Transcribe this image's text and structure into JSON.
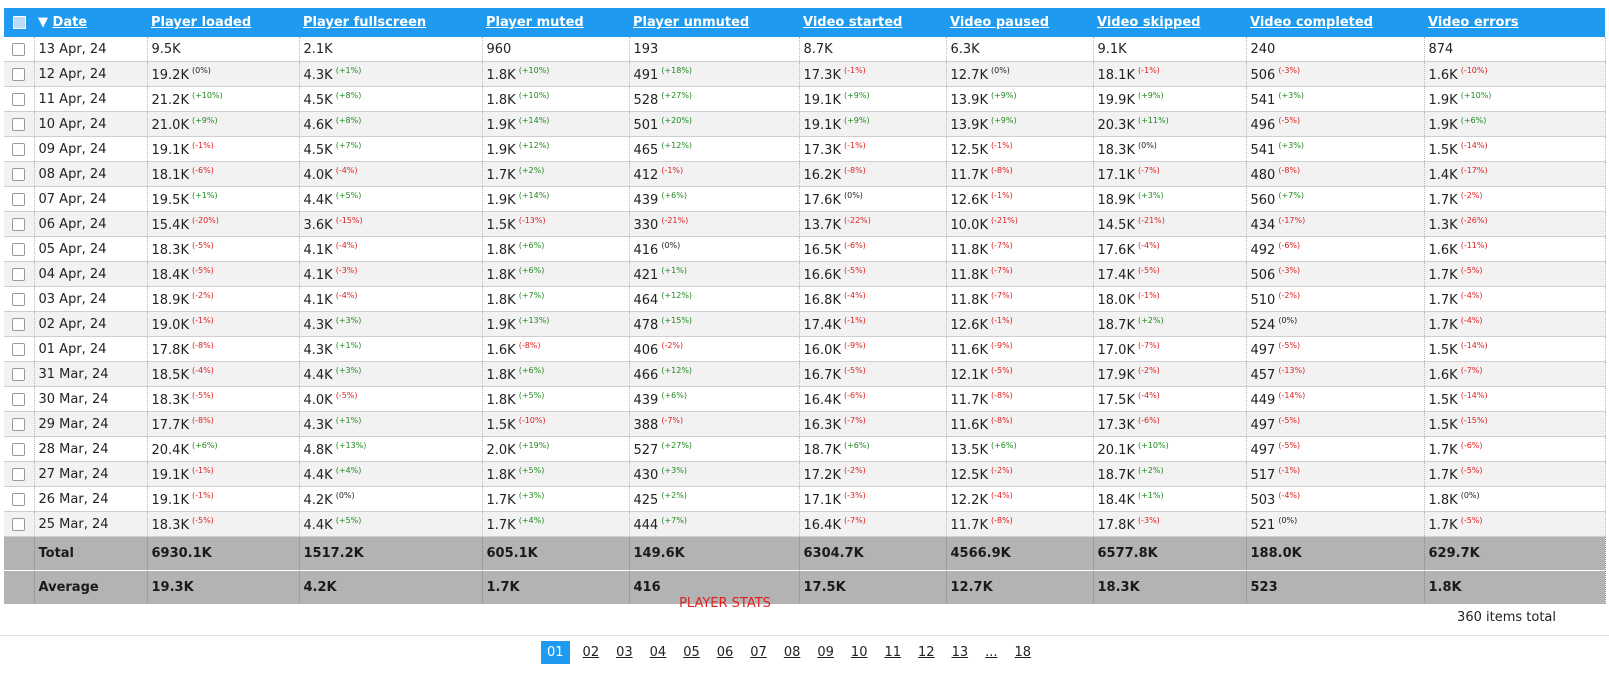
{
  "columns": {
    "date": "Date",
    "sort_glyph": "▼",
    "metrics": [
      "Player loaded",
      "Player fullscreen",
      "Player muted",
      "Player unmuted",
      "Video started",
      "Video paused",
      "Video skipped",
      "Video completed",
      "Video errors"
    ]
  },
  "rows": [
    {
      "date": "13 Apr, 24",
      "cells": [
        [
          "9.5K",
          ""
        ],
        [
          "2.1K",
          ""
        ],
        [
          "960",
          ""
        ],
        [
          "193",
          ""
        ],
        [
          "8.7K",
          ""
        ],
        [
          "6.3K",
          ""
        ],
        [
          "9.1K",
          ""
        ],
        [
          "240",
          ""
        ],
        [
          "874",
          ""
        ]
      ]
    },
    {
      "date": "12 Apr, 24",
      "cells": [
        [
          "19.2K",
          "(0%)"
        ],
        [
          "4.3K",
          "(+1%)"
        ],
        [
          "1.8K",
          "(+10%)"
        ],
        [
          "491",
          "(+18%)"
        ],
        [
          "17.3K",
          "(-1%)"
        ],
        [
          "12.7K",
          "(0%)"
        ],
        [
          "18.1K",
          "(-1%)"
        ],
        [
          "506",
          "(-3%)"
        ],
        [
          "1.6K",
          "(-10%)"
        ]
      ]
    },
    {
      "date": "11 Apr, 24",
      "cells": [
        [
          "21.2K",
          "(+10%)"
        ],
        [
          "4.5K",
          "(+8%)"
        ],
        [
          "1.8K",
          "(+10%)"
        ],
        [
          "528",
          "(+27%)"
        ],
        [
          "19.1K",
          "(+9%)"
        ],
        [
          "13.9K",
          "(+9%)"
        ],
        [
          "19.9K",
          "(+9%)"
        ],
        [
          "541",
          "(+3%)"
        ],
        [
          "1.9K",
          "(+10%)"
        ]
      ]
    },
    {
      "date": "10 Apr, 24",
      "cells": [
        [
          "21.0K",
          "(+9%)"
        ],
        [
          "4.6K",
          "(+8%)"
        ],
        [
          "1.9K",
          "(+14%)"
        ],
        [
          "501",
          "(+20%)"
        ],
        [
          "19.1K",
          "(+9%)"
        ],
        [
          "13.9K",
          "(+9%)"
        ],
        [
          "20.3K",
          "(+11%)"
        ],
        [
          "496",
          "(-5%)"
        ],
        [
          "1.9K",
          "(+6%)"
        ]
      ]
    },
    {
      "date": "09 Apr, 24",
      "cells": [
        [
          "19.1K",
          "(-1%)"
        ],
        [
          "4.5K",
          "(+7%)"
        ],
        [
          "1.9K",
          "(+12%)"
        ],
        [
          "465",
          "(+12%)"
        ],
        [
          "17.3K",
          "(-1%)"
        ],
        [
          "12.5K",
          "(-1%)"
        ],
        [
          "18.3K",
          "(0%)"
        ],
        [
          "541",
          "(+3%)"
        ],
        [
          "1.5K",
          "(-14%)"
        ]
      ]
    },
    {
      "date": "08 Apr, 24",
      "cells": [
        [
          "18.1K",
          "(-6%)"
        ],
        [
          "4.0K",
          "(-4%)"
        ],
        [
          "1.7K",
          "(+2%)"
        ],
        [
          "412",
          "(-1%)"
        ],
        [
          "16.2K",
          "(-8%)"
        ],
        [
          "11.7K",
          "(-8%)"
        ],
        [
          "17.1K",
          "(-7%)"
        ],
        [
          "480",
          "(-8%)"
        ],
        [
          "1.4K",
          "(-17%)"
        ]
      ]
    },
    {
      "date": "07 Apr, 24",
      "cells": [
        [
          "19.5K",
          "(+1%)"
        ],
        [
          "4.4K",
          "(+5%)"
        ],
        [
          "1.9K",
          "(+14%)"
        ],
        [
          "439",
          "(+6%)"
        ],
        [
          "17.6K",
          "(0%)"
        ],
        [
          "12.6K",
          "(-1%)"
        ],
        [
          "18.9K",
          "(+3%)"
        ],
        [
          "560",
          "(+7%)"
        ],
        [
          "1.7K",
          "(-2%)"
        ]
      ]
    },
    {
      "date": "06 Apr, 24",
      "cells": [
        [
          "15.4K",
          "(-20%)"
        ],
        [
          "3.6K",
          "(-15%)"
        ],
        [
          "1.5K",
          "(-13%)"
        ],
        [
          "330",
          "(-21%)"
        ],
        [
          "13.7K",
          "(-22%)"
        ],
        [
          "10.0K",
          "(-21%)"
        ],
        [
          "14.5K",
          "(-21%)"
        ],
        [
          "434",
          "(-17%)"
        ],
        [
          "1.3K",
          "(-26%)"
        ]
      ]
    },
    {
      "date": "05 Apr, 24",
      "cells": [
        [
          "18.3K",
          "(-5%)"
        ],
        [
          "4.1K",
          "(-4%)"
        ],
        [
          "1.8K",
          "(+6%)"
        ],
        [
          "416",
          "(0%)"
        ],
        [
          "16.5K",
          "(-6%)"
        ],
        [
          "11.8K",
          "(-7%)"
        ],
        [
          "17.6K",
          "(-4%)"
        ],
        [
          "492",
          "(-6%)"
        ],
        [
          "1.6K",
          "(-11%)"
        ]
      ]
    },
    {
      "date": "04 Apr, 24",
      "cells": [
        [
          "18.4K",
          "(-5%)"
        ],
        [
          "4.1K",
          "(-3%)"
        ],
        [
          "1.8K",
          "(+6%)"
        ],
        [
          "421",
          "(+1%)"
        ],
        [
          "16.6K",
          "(-5%)"
        ],
        [
          "11.8K",
          "(-7%)"
        ],
        [
          "17.4K",
          "(-5%)"
        ],
        [
          "506",
          "(-3%)"
        ],
        [
          "1.7K",
          "(-5%)"
        ]
      ]
    },
    {
      "date": "03 Apr, 24",
      "cells": [
        [
          "18.9K",
          "(-2%)"
        ],
        [
          "4.1K",
          "(-4%)"
        ],
        [
          "1.8K",
          "(+7%)"
        ],
        [
          "464",
          "(+12%)"
        ],
        [
          "16.8K",
          "(-4%)"
        ],
        [
          "11.8K",
          "(-7%)"
        ],
        [
          "18.0K",
          "(-1%)"
        ],
        [
          "510",
          "(-2%)"
        ],
        [
          "1.7K",
          "(-4%)"
        ]
      ]
    },
    {
      "date": "02 Apr, 24",
      "cells": [
        [
          "19.0K",
          "(-1%)"
        ],
        [
          "4.3K",
          "(+3%)"
        ],
        [
          "1.9K",
          "(+13%)"
        ],
        [
          "478",
          "(+15%)"
        ],
        [
          "17.4K",
          "(-1%)"
        ],
        [
          "12.6K",
          "(-1%)"
        ],
        [
          "18.7K",
          "(+2%)"
        ],
        [
          "524",
          "(0%)"
        ],
        [
          "1.7K",
          "(-4%)"
        ]
      ]
    },
    {
      "date": "01 Apr, 24",
      "cells": [
        [
          "17.8K",
          "(-8%)"
        ],
        [
          "4.3K",
          "(+1%)"
        ],
        [
          "1.6K",
          "(-8%)"
        ],
        [
          "406",
          "(-2%)"
        ],
        [
          "16.0K",
          "(-9%)"
        ],
        [
          "11.6K",
          "(-9%)"
        ],
        [
          "17.0K",
          "(-7%)"
        ],
        [
          "497",
          "(-5%)"
        ],
        [
          "1.5K",
          "(-14%)"
        ]
      ]
    },
    {
      "date": "31 Mar, 24",
      "cells": [
        [
          "18.5K",
          "(-4%)"
        ],
        [
          "4.4K",
          "(+3%)"
        ],
        [
          "1.8K",
          "(+6%)"
        ],
        [
          "466",
          "(+12%)"
        ],
        [
          "16.7K",
          "(-5%)"
        ],
        [
          "12.1K",
          "(-5%)"
        ],
        [
          "17.9K",
          "(-2%)"
        ],
        [
          "457",
          "(-13%)"
        ],
        [
          "1.6K",
          "(-7%)"
        ]
      ]
    },
    {
      "date": "30 Mar, 24",
      "cells": [
        [
          "18.3K",
          "(-5%)"
        ],
        [
          "4.0K",
          "(-5%)"
        ],
        [
          "1.8K",
          "(+5%)"
        ],
        [
          "439",
          "(+6%)"
        ],
        [
          "16.4K",
          "(-6%)"
        ],
        [
          "11.7K",
          "(-8%)"
        ],
        [
          "17.5K",
          "(-4%)"
        ],
        [
          "449",
          "(-14%)"
        ],
        [
          "1.5K",
          "(-14%)"
        ]
      ]
    },
    {
      "date": "29 Mar, 24",
      "cells": [
        [
          "17.7K",
          "(-8%)"
        ],
        [
          "4.3K",
          "(+1%)"
        ],
        [
          "1.5K",
          "(-10%)"
        ],
        [
          "388",
          "(-7%)"
        ],
        [
          "16.3K",
          "(-7%)"
        ],
        [
          "11.6K",
          "(-8%)"
        ],
        [
          "17.3K",
          "(-6%)"
        ],
        [
          "497",
          "(-5%)"
        ],
        [
          "1.5K",
          "(-15%)"
        ]
      ]
    },
    {
      "date": "28 Mar, 24",
      "cells": [
        [
          "20.4K",
          "(+6%)"
        ],
        [
          "4.8K",
          "(+13%)"
        ],
        [
          "2.0K",
          "(+19%)"
        ],
        [
          "527",
          "(+27%)"
        ],
        [
          "18.7K",
          "(+6%)"
        ],
        [
          "13.5K",
          "(+6%)"
        ],
        [
          "20.1K",
          "(+10%)"
        ],
        [
          "497",
          "(-5%)"
        ],
        [
          "1.7K",
          "(-6%)"
        ]
      ]
    },
    {
      "date": "27 Mar, 24",
      "cells": [
        [
          "19.1K",
          "(-1%)"
        ],
        [
          "4.4K",
          "(+4%)"
        ],
        [
          "1.8K",
          "(+5%)"
        ],
        [
          "430",
          "(+3%)"
        ],
        [
          "17.2K",
          "(-2%)"
        ],
        [
          "12.5K",
          "(-2%)"
        ],
        [
          "18.7K",
          "(+2%)"
        ],
        [
          "517",
          "(-1%)"
        ],
        [
          "1.7K",
          "(-5%)"
        ]
      ]
    },
    {
      "date": "26 Mar, 24",
      "cells": [
        [
          "19.1K",
          "(-1%)"
        ],
        [
          "4.2K",
          "(0%)"
        ],
        [
          "1.7K",
          "(+3%)"
        ],
        [
          "425",
          "(+2%)"
        ],
        [
          "17.1K",
          "(-3%)"
        ],
        [
          "12.2K",
          "(-4%)"
        ],
        [
          "18.4K",
          "(+1%)"
        ],
        [
          "503",
          "(-4%)"
        ],
        [
          "1.8K",
          "(0%)"
        ]
      ]
    },
    {
      "date": "25 Mar, 24",
      "cells": [
        [
          "18.3K",
          "(-5%)"
        ],
        [
          "4.4K",
          "(+5%)"
        ],
        [
          "1.7K",
          "(+4%)"
        ],
        [
          "444",
          "(+7%)"
        ],
        [
          "16.4K",
          "(-7%)"
        ],
        [
          "11.7K",
          "(-8%)"
        ],
        [
          "17.8K",
          "(-3%)"
        ],
        [
          "521",
          "(0%)"
        ],
        [
          "1.7K",
          "(-5%)"
        ]
      ]
    }
  ],
  "totals": {
    "label": "Total",
    "values": [
      "6930.1K",
      "1517.2K",
      "605.1K",
      "149.6K",
      "6304.7K",
      "4566.9K",
      "6577.8K",
      "188.0K",
      "629.7K"
    ]
  },
  "averages": {
    "label": "Average",
    "values": [
      "19.3K",
      "4.2K",
      "1.7K",
      "416",
      "17.5K",
      "12.7K",
      "18.3K",
      "523",
      "1.8K"
    ]
  },
  "caption": "PLAYER STATS",
  "items_total": "360 items total",
  "pagination": {
    "pages": [
      "01",
      "02",
      "03",
      "04",
      "05",
      "06",
      "07",
      "08",
      "09",
      "10",
      "11",
      "12",
      "13",
      "...",
      "18"
    ],
    "active": "01"
  },
  "colors": {
    "header_blue": "#1e9bf0",
    "positive": "#1f8a1f",
    "negative": "#e01e1e",
    "footer_gray": "#b3b3b3"
  }
}
